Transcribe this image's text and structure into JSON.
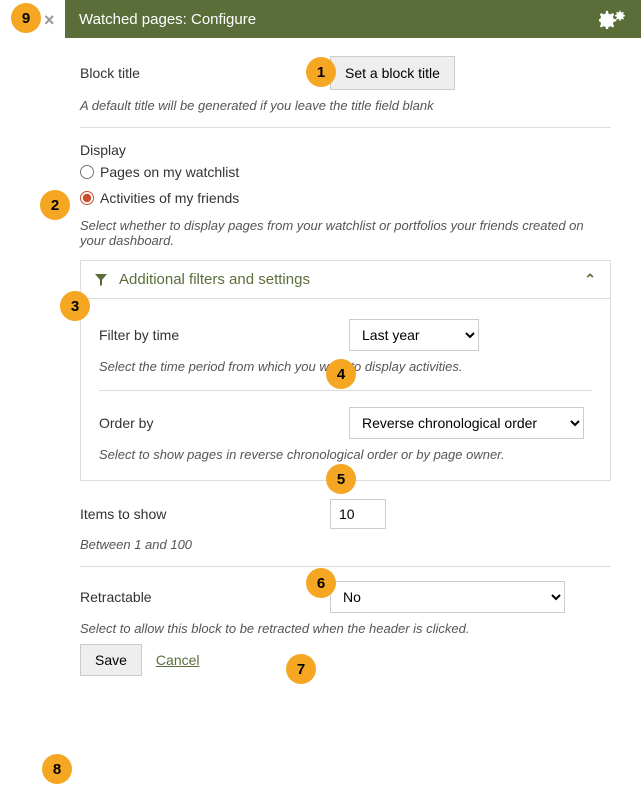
{
  "header": {
    "title": "Watched pages: Configure"
  },
  "block_title": {
    "label": "Block title",
    "button": "Set a block title",
    "hint": "A default title will be generated if you leave the title field blank"
  },
  "display": {
    "label": "Display",
    "option1": "Pages on my watchlist",
    "option2": "Activities of my friends",
    "hint": "Select whether to display pages from your watchlist or portfolios your friends created on your dashboard."
  },
  "filters": {
    "title": "Additional filters and settings",
    "filter_time": {
      "label": "Filter by time",
      "value": "Last year",
      "hint": "Select the time period from which you want to display activities."
    },
    "order_by": {
      "label": "Order by",
      "value": "Reverse chronological order",
      "hint": "Select to show pages in reverse chronological order or by page owner."
    }
  },
  "items": {
    "label": "Items to show",
    "value": "10",
    "hint": "Between 1 and 100"
  },
  "retractable": {
    "label": "Retractable",
    "value": "No",
    "hint": "Select to allow this block to be retracted when the header is clicked."
  },
  "actions": {
    "save": "Save",
    "cancel": "Cancel"
  },
  "badges": {
    "b1": "1",
    "b2": "2",
    "b3": "3",
    "b4": "4",
    "b5": "5",
    "b6": "6",
    "b7": "7",
    "b8": "8",
    "b9": "9"
  }
}
